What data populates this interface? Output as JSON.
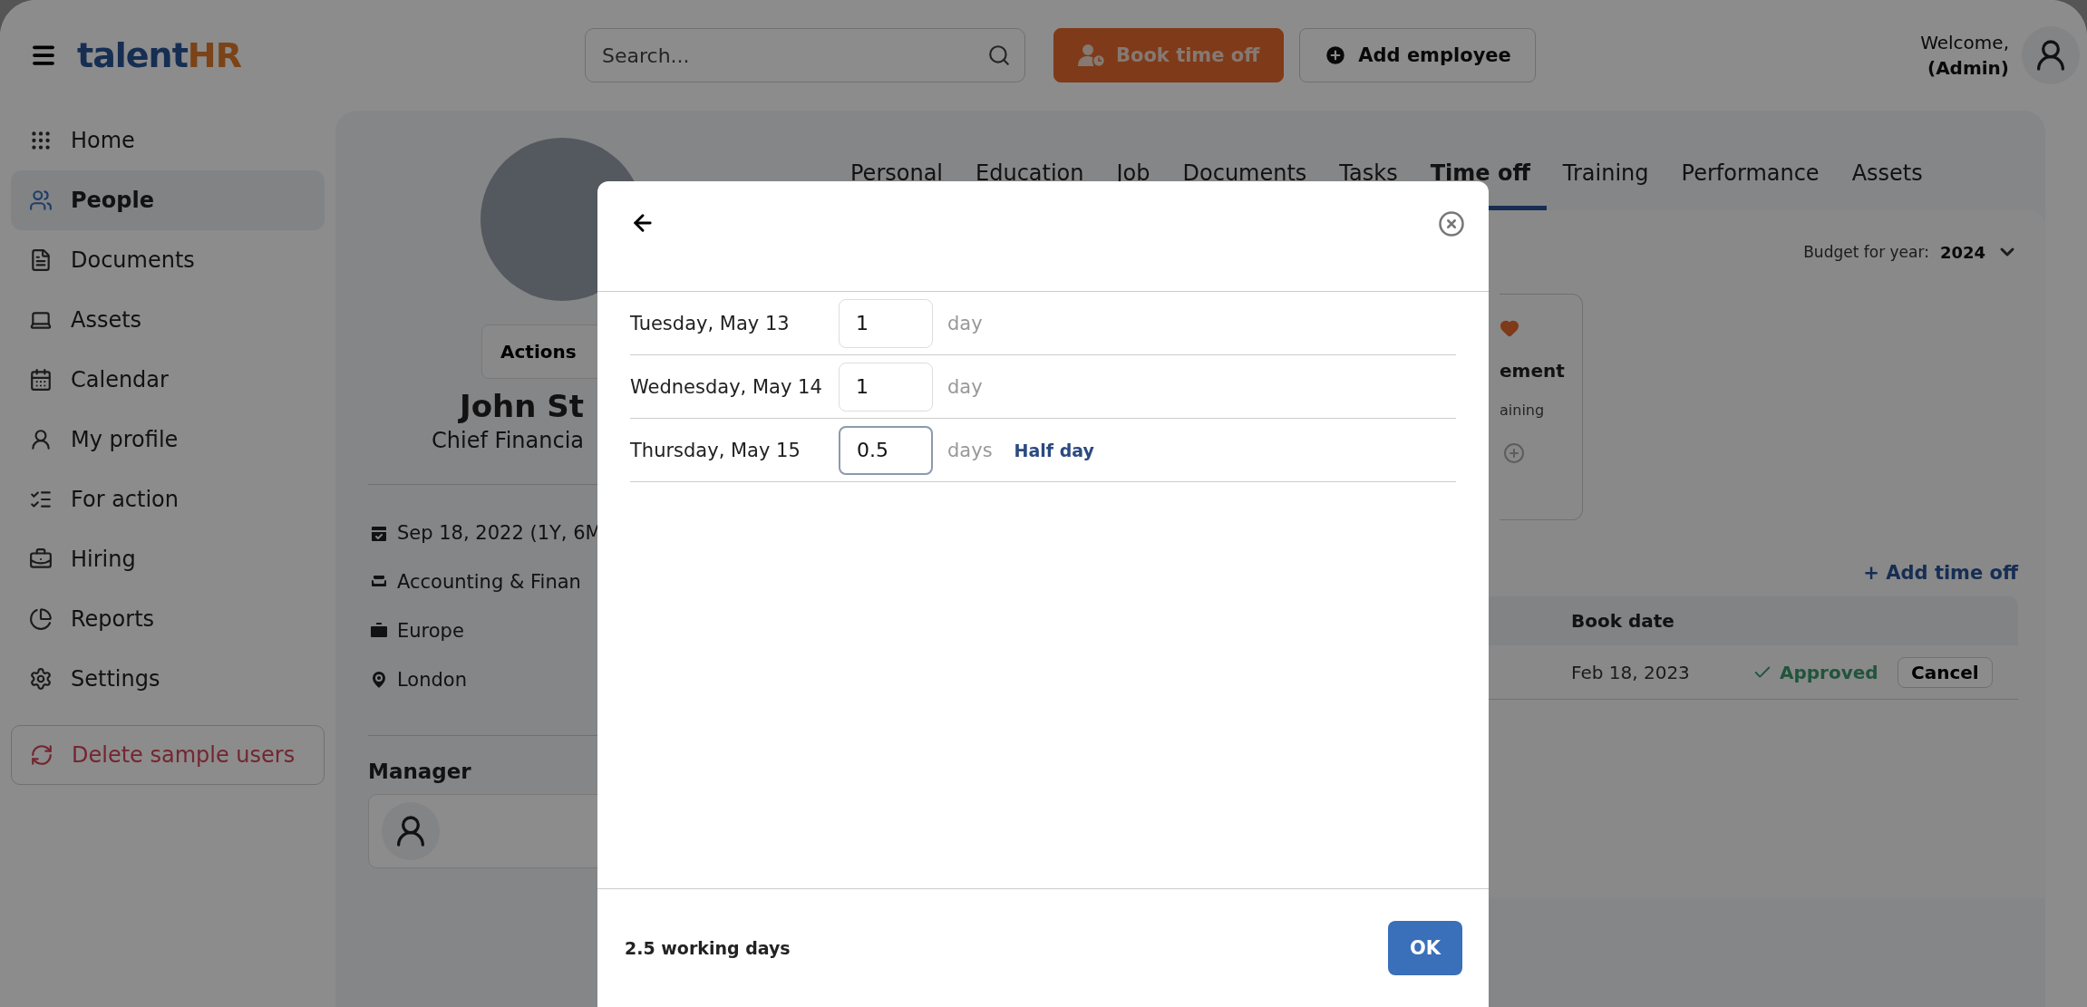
{
  "top_bar": {
    "logo": {
      "text": "talent",
      "accent": "HR"
    },
    "search": {
      "placeholder": "Search..."
    },
    "buttons": [
      {
        "label": "Book time off",
        "kind": "primary"
      },
      {
        "label": "Add employee",
        "kind": "secondary"
      }
    ],
    "user": {
      "greeting": "Welcome,",
      "role": "(Admin)"
    }
  },
  "sidebar": {
    "items": [
      {
        "label": "Home",
        "selected": false
      },
      {
        "label": "People",
        "selected": true
      },
      {
        "label": "Documents",
        "selected": false
      },
      {
        "label": "Assets",
        "selected": false
      },
      {
        "label": "Calendar",
        "selected": false
      },
      {
        "label": "My profile",
        "selected": false
      },
      {
        "label": "For action",
        "selected": false
      },
      {
        "label": "Hiring",
        "selected": false
      },
      {
        "label": "Reports",
        "selected": false
      },
      {
        "label": "Settings",
        "selected": false
      }
    ],
    "action": {
      "label": "Delete sample users"
    }
  },
  "profile": {
    "actions_button": "Actions",
    "name": "John St",
    "job_title": "Chief Financia",
    "details": [
      {
        "text": "Sep 18, 2022 (1Y, 6M"
      },
      {
        "text": "Accounting & Finan"
      },
      {
        "text": "Europe"
      },
      {
        "text": "London"
      }
    ],
    "manager": {
      "heading": "Manager"
    }
  },
  "tabs": [
    {
      "label": "Personal",
      "selected": false
    },
    {
      "label": "Education",
      "selected": false
    },
    {
      "label": "Job",
      "selected": false
    },
    {
      "label": "Documents",
      "selected": false
    },
    {
      "label": "Tasks",
      "selected": false
    },
    {
      "label": "Time off",
      "selected": true
    },
    {
      "label": "Training",
      "selected": false
    },
    {
      "label": "Performance",
      "selected": false
    },
    {
      "label": "Assets",
      "selected": false
    }
  ],
  "time_off": {
    "budget": {
      "label": "Budget for year:",
      "year": "2024"
    },
    "card": {
      "title": "ement",
      "subtitle": "aining"
    },
    "add_link": "+ Add time off",
    "table": {
      "columns": [
        "Book date"
      ],
      "rows": [
        {
          "book_date": "Feb 18, 2023",
          "status": "Approved",
          "action": "Cancel"
        }
      ]
    }
  },
  "dialog": {
    "rows": [
      {
        "date": "Tuesday, May 13",
        "value": "1",
        "unit": "day",
        "focused": false
      },
      {
        "date": "Wednesday, May 14",
        "value": "1",
        "unit": "day",
        "focused": false
      },
      {
        "date": "Thursday, May 15",
        "value": "0.5",
        "unit": "days",
        "focused": true,
        "note": "Half day"
      }
    ],
    "total": "2.5 working days",
    "ok": "OK"
  }
}
